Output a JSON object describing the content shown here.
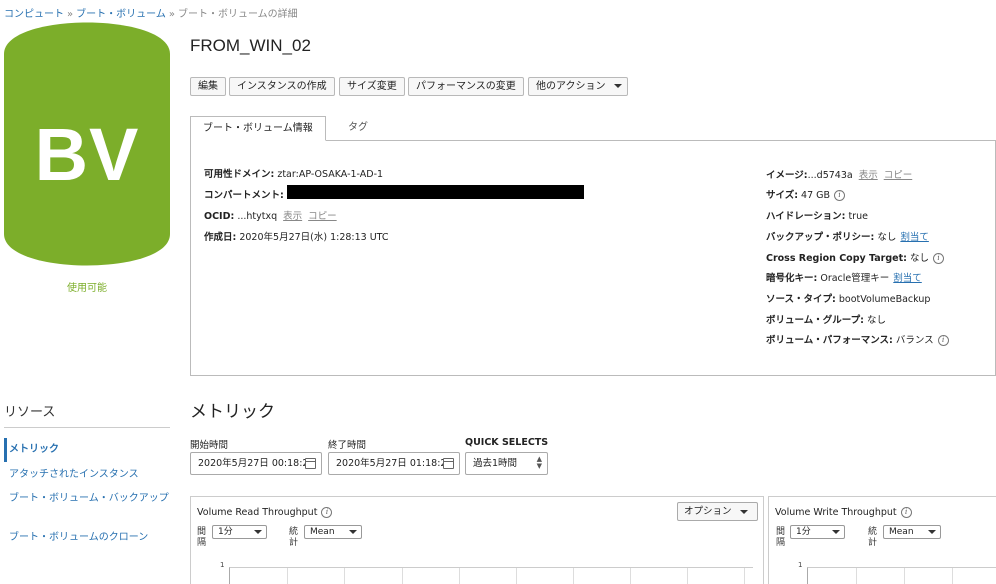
{
  "breadcrumb": {
    "items": [
      "コンピュート",
      "ブート・ボリューム"
    ],
    "current": "ブート・ボリュームの詳細",
    "separator": "»"
  },
  "resource_icon": {
    "text": "BV",
    "color": "#7cae2a"
  },
  "status": "使用可能",
  "title": "FROM_WIN_02",
  "actions": {
    "edit": "編集",
    "create_instance": "インスタンスの作成",
    "resize": "サイズ変更",
    "change_performance": "パフォーマンスの変更",
    "more_actions": "他のアクション"
  },
  "tabs": {
    "info": "ブート・ボリューム情報",
    "tags": "タグ"
  },
  "details_left": {
    "availability_domain": {
      "label": "可用性ドメイン:",
      "value": "ztar:AP-OSAKA-1-AD-1"
    },
    "compartment": {
      "label": "コンパートメント:"
    },
    "ocid": {
      "label": "OCID:",
      "value": "...htytxq",
      "show": "表示",
      "copy": "コピー"
    },
    "created": {
      "label": "作成日:",
      "value": "2020年5月27日(水) 1:28:13 UTC"
    }
  },
  "details_right": {
    "image": {
      "label": "イメージ:",
      "value": "...d5743a",
      "show": "表示",
      "copy": "コピー"
    },
    "size": {
      "label": "サイズ:",
      "value": "47 GB"
    },
    "hydration": {
      "label": "ハイドレーション:",
      "value": "true"
    },
    "backup_policy": {
      "label": "バックアップ・ポリシー:",
      "value": "なし",
      "assign": "割当て"
    },
    "cross_region": {
      "label": "Cross Region Copy Target:",
      "value": "なし"
    },
    "encryption_key": {
      "label": "暗号化キー:",
      "value": "Oracle管理キー",
      "assign": "割当て"
    },
    "source_type": {
      "label": "ソース・タイプ:",
      "value": "bootVolumeBackup"
    },
    "volume_group": {
      "label": "ボリューム・グループ:",
      "value": "なし"
    },
    "volume_performance": {
      "label": "ボリューム・パフォーマンス:",
      "value": "バランス"
    }
  },
  "resources": {
    "title": "リソース",
    "items": [
      "メトリック",
      "アタッチされたインスタンス",
      "ブート・ボリューム・バックアップ",
      "ブート・ボリュームのクローン"
    ]
  },
  "metrics": {
    "title": "メトリック",
    "start_label": "開始時間",
    "start_value": "2020年5月27日 00:18:2",
    "end_label": "終了時間",
    "end_value": "2020年5月27日 01:18:2",
    "quick_label": "QUICK SELECTS",
    "quick_value": "過去1時間",
    "charts": [
      {
        "title": "Volume Read Throughput",
        "options": "オプション",
        "interval_label": "間隔",
        "interval": "1分",
        "stat_label": "統計",
        "stat": "Mean",
        "ytick": "1"
      },
      {
        "title": "Volume Write Throughput",
        "interval_label": "間隔",
        "interval": "1分",
        "stat_label": "統計",
        "stat": "Mean",
        "ytick": "1"
      }
    ]
  }
}
